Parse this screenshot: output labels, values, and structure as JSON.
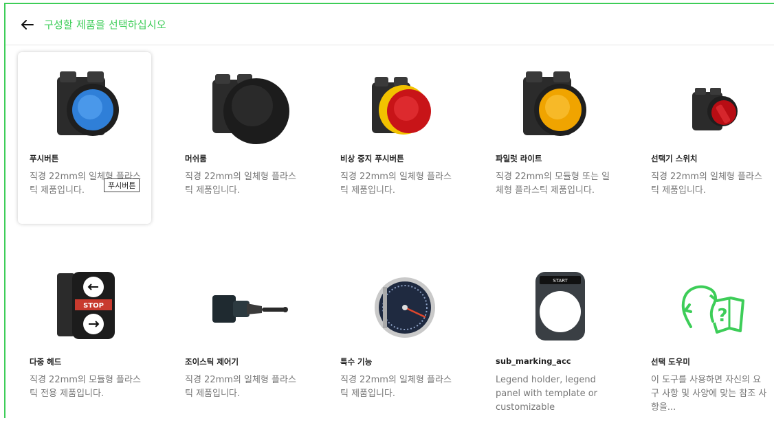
{
  "header": {
    "back_icon": "arrow-left-icon",
    "title": "구성할 제품을 선택하십시오",
    "accent": "#3dcd58"
  },
  "products": [
    {
      "name": "푸시버튼",
      "desc": "직경 22mm의 일체형 플라스틱 제품입니다.",
      "icon": "blue-pushbutton-image",
      "tooltip": "푸시버튼",
      "selected": true
    },
    {
      "name": "머쉬룸",
      "desc": "직경 22mm의 일체형 플라스틱 제품입니다.",
      "icon": "mushroom-button-image"
    },
    {
      "name": "비상 중지 푸시버튼",
      "desc": "직경 22mm의 일체형 플라스틱 제품입니다.",
      "icon": "emergency-stop-image"
    },
    {
      "name": "파일럿 라이트",
      "desc": "직경 22mm의 모듈형 또는 일체형 플라스틱 제품입니다.",
      "icon": "pilot-light-image"
    },
    {
      "name": "선택기 스위치",
      "desc": "직경 22mm의 일체형 플라스틱 제품입니다.",
      "icon": "selector-switch-image"
    },
    {
      "name": "다중 헤드",
      "desc": "직경 22mm의 모듈형 플라스틱 전용 제품입니다.",
      "icon": "multi-head-image",
      "stop_label": "STOP"
    },
    {
      "name": "조이스틱 제어기",
      "desc": "직경 22mm의 일체형 플라스틱 제품입니다.",
      "icon": "joystick-image"
    },
    {
      "name": "특수 기능",
      "desc": "직경 22mm의 일체형 플라스틱 제품입니다.",
      "icon": "gauge-image"
    },
    {
      "name": "sub_marking_acc",
      "desc": "Legend holder, legend panel with template or customizable",
      "icon": "legend-holder-image",
      "legend_label": "START"
    },
    {
      "name": "선택 도우미",
      "desc": "이 도구를 사용하면 자신의 요구 사항 및 사양에 맞는 참조 사항을...",
      "icon": "help-guide-icon"
    }
  ]
}
